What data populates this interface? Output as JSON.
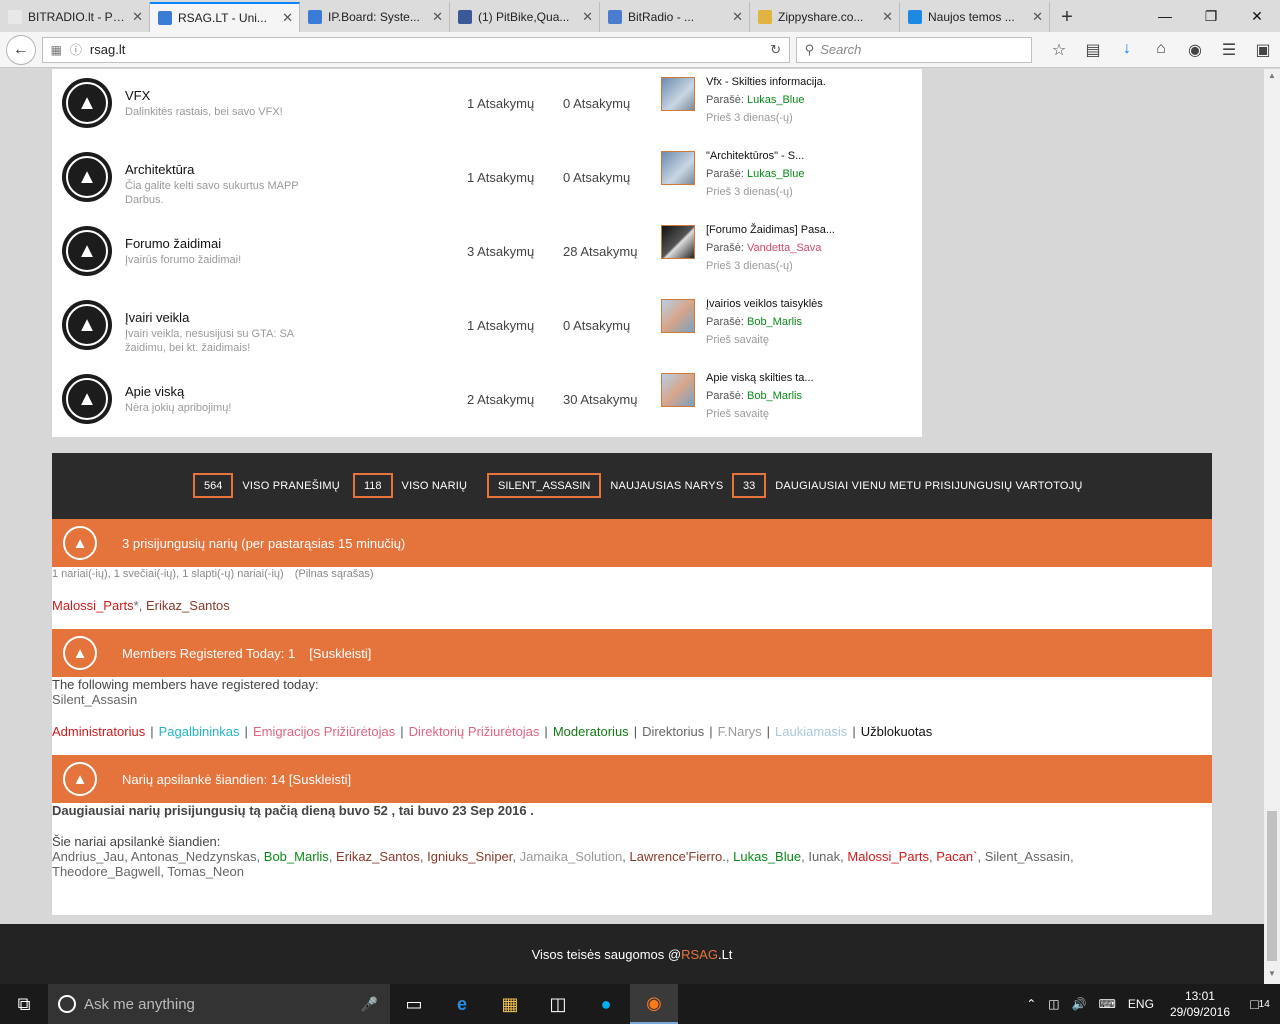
{
  "browser": {
    "tabs": [
      {
        "title": "BITRADIO.lt - Pagri...",
        "favicon_color": "#e8e8e8",
        "active": false
      },
      {
        "title": "RSAG.LT - Uni...",
        "favicon_color": "#3a7bd5",
        "active": true
      },
      {
        "title": "IP.Board: Syste...",
        "favicon_color": "#3a7bd5",
        "active": false
      },
      {
        "title": "(1) PitBike,Qua...",
        "favicon_color": "#3b5998",
        "active": false
      },
      {
        "title": "BitRadio - ...",
        "favicon_color": "#4a7dcf",
        "active": false
      },
      {
        "title": "Zippyshare.co...",
        "favicon_color": "#e3b340",
        "active": false
      },
      {
        "title": "Naujos temos ...",
        "favicon_color": "#1e88e5",
        "active": false
      }
    ],
    "url": "rsag.lt",
    "search_placeholder": "Search"
  },
  "forums": [
    {
      "title": "VFX",
      "desc": "Dalinkitės rastais, bei savo VFX!",
      "topics": "1  Atsakymų",
      "posts": "0 Atsakymų",
      "last_title": "Vfx - Skilties informacija.",
      "by_label": "Parašė:",
      "last_by": "Lukas_Blue",
      "by_color": "green",
      "when": "Prieš 3 dienas(-ų)",
      "avatar": "normal"
    },
    {
      "title": "Architektūra",
      "desc": "Čia galite kelti savo sukurtus MAPP Darbus.",
      "topics": "1  Atsakymų",
      "posts": "0 Atsakymų",
      "last_title": "\"Architektūros\" - S...",
      "by_label": "Parašė:",
      "last_by": "Lukas_Blue",
      "by_color": "green",
      "when": "Prieš 3 dienas(-ų)",
      "avatar": "normal"
    },
    {
      "title": "Forumo žaidimai",
      "desc": "Įvairūs forumo žaidimai!",
      "topics": "3  Atsakymų",
      "posts": "28 Atsakymų",
      "last_title": "[Forumo Žaidimas] Pasa...",
      "by_label": "Parašė:",
      "last_by": "Vandetta_Sava",
      "by_color": "rose",
      "when": "Prieš 3 dienas(-ų)",
      "avatar": "dark"
    },
    {
      "title": "Įvairi veikla",
      "desc": "Įvairi veikla, nesusijusi su GTA: SA žaidimu, bei kt. žaidimais!",
      "topics": "1  Atsakymų",
      "posts": "0 Atsakymų",
      "last_title": "Įvairios veiklos taisyklės",
      "by_label": "Parašė:",
      "last_by": "Bob_Marlis",
      "by_color": "green",
      "when": "Prieš savaitę",
      "avatar": "light"
    },
    {
      "title": "Apie viską",
      "desc": "Nėra jokių apribojimų!",
      "topics": "2  Atsakymų",
      "posts": "30 Atsakymų",
      "last_title": "Apie viską skilties ta...",
      "by_label": "Parašė:",
      "last_by": "Bob_Marlis",
      "by_color": "green",
      "when": "Prieš savaitę",
      "avatar": "light"
    }
  ],
  "stats": [
    {
      "value": "564",
      "label": "VISO PRANEŠIMŲ"
    },
    {
      "value": "118",
      "label": "VISO NARIŲ"
    },
    {
      "value": "SILENT_ASSASIN",
      "label": "NAUJAUSIAS NARYS"
    },
    {
      "value": "33",
      "label": "DAUGIAUSIAI VIENU METU PRISIJUNGUSIŲ VARTOTOJŲ"
    }
  ],
  "online": {
    "header": "3 prisijungusių narių (per pastarąsias 15 minučių)",
    "summary": "1 nariai(-ių), 1 svečiai(-ių), 1 slapti(-ų) nariai(-ių)",
    "full_list": "(Pilnas sąrašas)",
    "user1": "Malossi_Parts",
    "user1_suffix": "*,",
    "user2": "Erikaz_Santos"
  },
  "registered": {
    "header": "Members Registered Today: 1",
    "collapse": "[Suskleisti]",
    "text": "The following members have registered today:",
    "member": "Silent_Assasin"
  },
  "groups": [
    {
      "name": "Administratorius",
      "color": "red"
    },
    {
      "name": "Pagalbininkas",
      "color": "cyan"
    },
    {
      "name": "Emigracijos Prižiūrėtojas",
      "color": "pink"
    },
    {
      "name": "Direktorių Prižiurėtojas",
      "color": "pink"
    },
    {
      "name": "Moderatorius",
      "color": "dgreen"
    },
    {
      "name": "Direktorius",
      "color": "gray"
    },
    {
      "name": "F.Narys",
      "color": "lgray"
    },
    {
      "name": "Laukiamasis",
      "color": "lblue"
    },
    {
      "name": "Užblokuotas",
      "color": "black"
    }
  ],
  "visitors": {
    "header": "Narių apsilankė šiandien: 14 [Suskleisti]",
    "record": "Daugiausiai narių prisijungusių tą pačią dieną buvo 52 , tai buvo 23 Sep 2016 .",
    "intro": "Šie nariai apsilankė šiandien:",
    "names": [
      {
        "name": "Andrius_Jau",
        "color": "gray"
      },
      {
        "name": "Antonas_Nedzynskas",
        "color": "gray"
      },
      {
        "name": "Bob_Marlis",
        "color": "green"
      },
      {
        "name": "Erikaz_Santos",
        "color": "brown"
      },
      {
        "name": "Igniuks_Sniper",
        "color": "brown"
      },
      {
        "name": "Jamaika_Solution",
        "color": "lgray"
      },
      {
        "name": "Lawrence'Fierro.",
        "color": "brown"
      },
      {
        "name": "Lukas_Blue",
        "color": "green"
      },
      {
        "name": "Iunak",
        "color": "gray"
      },
      {
        "name": "Malossi_Parts",
        "color": "red"
      },
      {
        "name": "Pacan`",
        "color": "red"
      },
      {
        "name": "Silent_Assasin",
        "color": "gray"
      },
      {
        "name": "Theodore_Bagwell",
        "color": "gray"
      },
      {
        "name": "Tomas_Neon",
        "color": "gray"
      }
    ]
  },
  "footer": {
    "prefix": "Visos teisės saugomos @ ",
    "brand_r": "R",
    "brand_sag": "SAG",
    "suffix": ".Lt"
  },
  "taskbar": {
    "search_placeholder": "Ask me anything",
    "lang": "ENG",
    "time": "13:01",
    "date": "29/09/2016",
    "notifications": "14"
  }
}
